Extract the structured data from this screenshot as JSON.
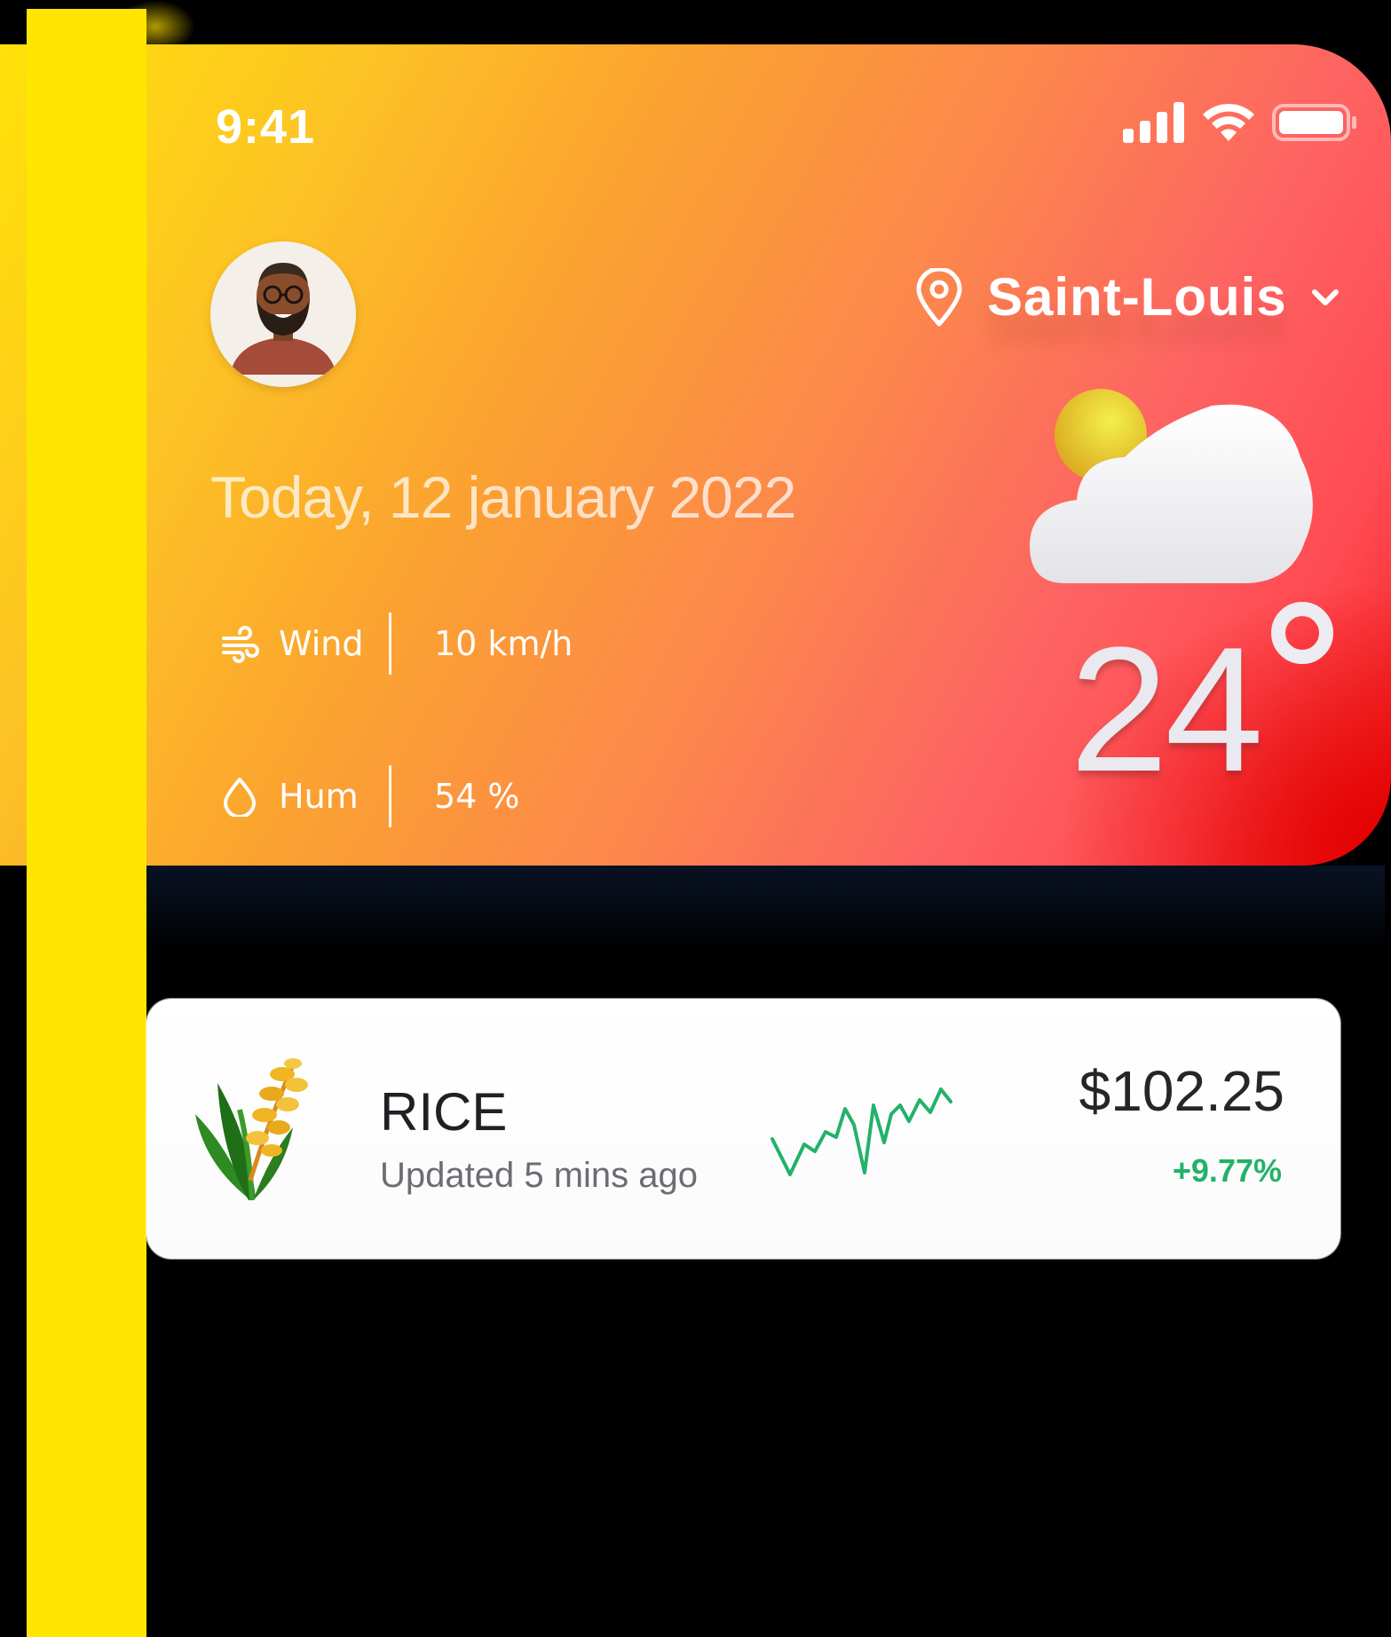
{
  "status_bar": {
    "time": "9:41",
    "signal_icon": "cellular-signal-icon",
    "wifi_icon": "wifi-icon",
    "battery_icon": "battery-icon"
  },
  "header": {
    "avatar_icon": "user-avatar",
    "location": {
      "icon": "location-pin-icon",
      "name": "Saint-Louis",
      "dropdown_icon": "chevron-down-icon"
    }
  },
  "weather": {
    "date": "Today, 12 january 2022",
    "wind": {
      "icon": "wind-icon",
      "label": "Wind",
      "value": "10 km/h"
    },
    "humidity": {
      "icon": "droplet-icon",
      "label": "Hum",
      "value": "54 %"
    },
    "condition_icon": "partly-cloudy-icon",
    "temperature": "24"
  },
  "commodity": {
    "icon": "rice-plant-icon",
    "name": "RICE",
    "updated": "Updated 5 mins ago",
    "price": "$102.25",
    "change": "+9.77%",
    "trend_color": "#22b26a"
  },
  "colors": {
    "accent_yellow": "#ffe600",
    "gradient_start": "#ffe208",
    "gradient_end": "#f21c1c",
    "positive": "#22b26a"
  }
}
